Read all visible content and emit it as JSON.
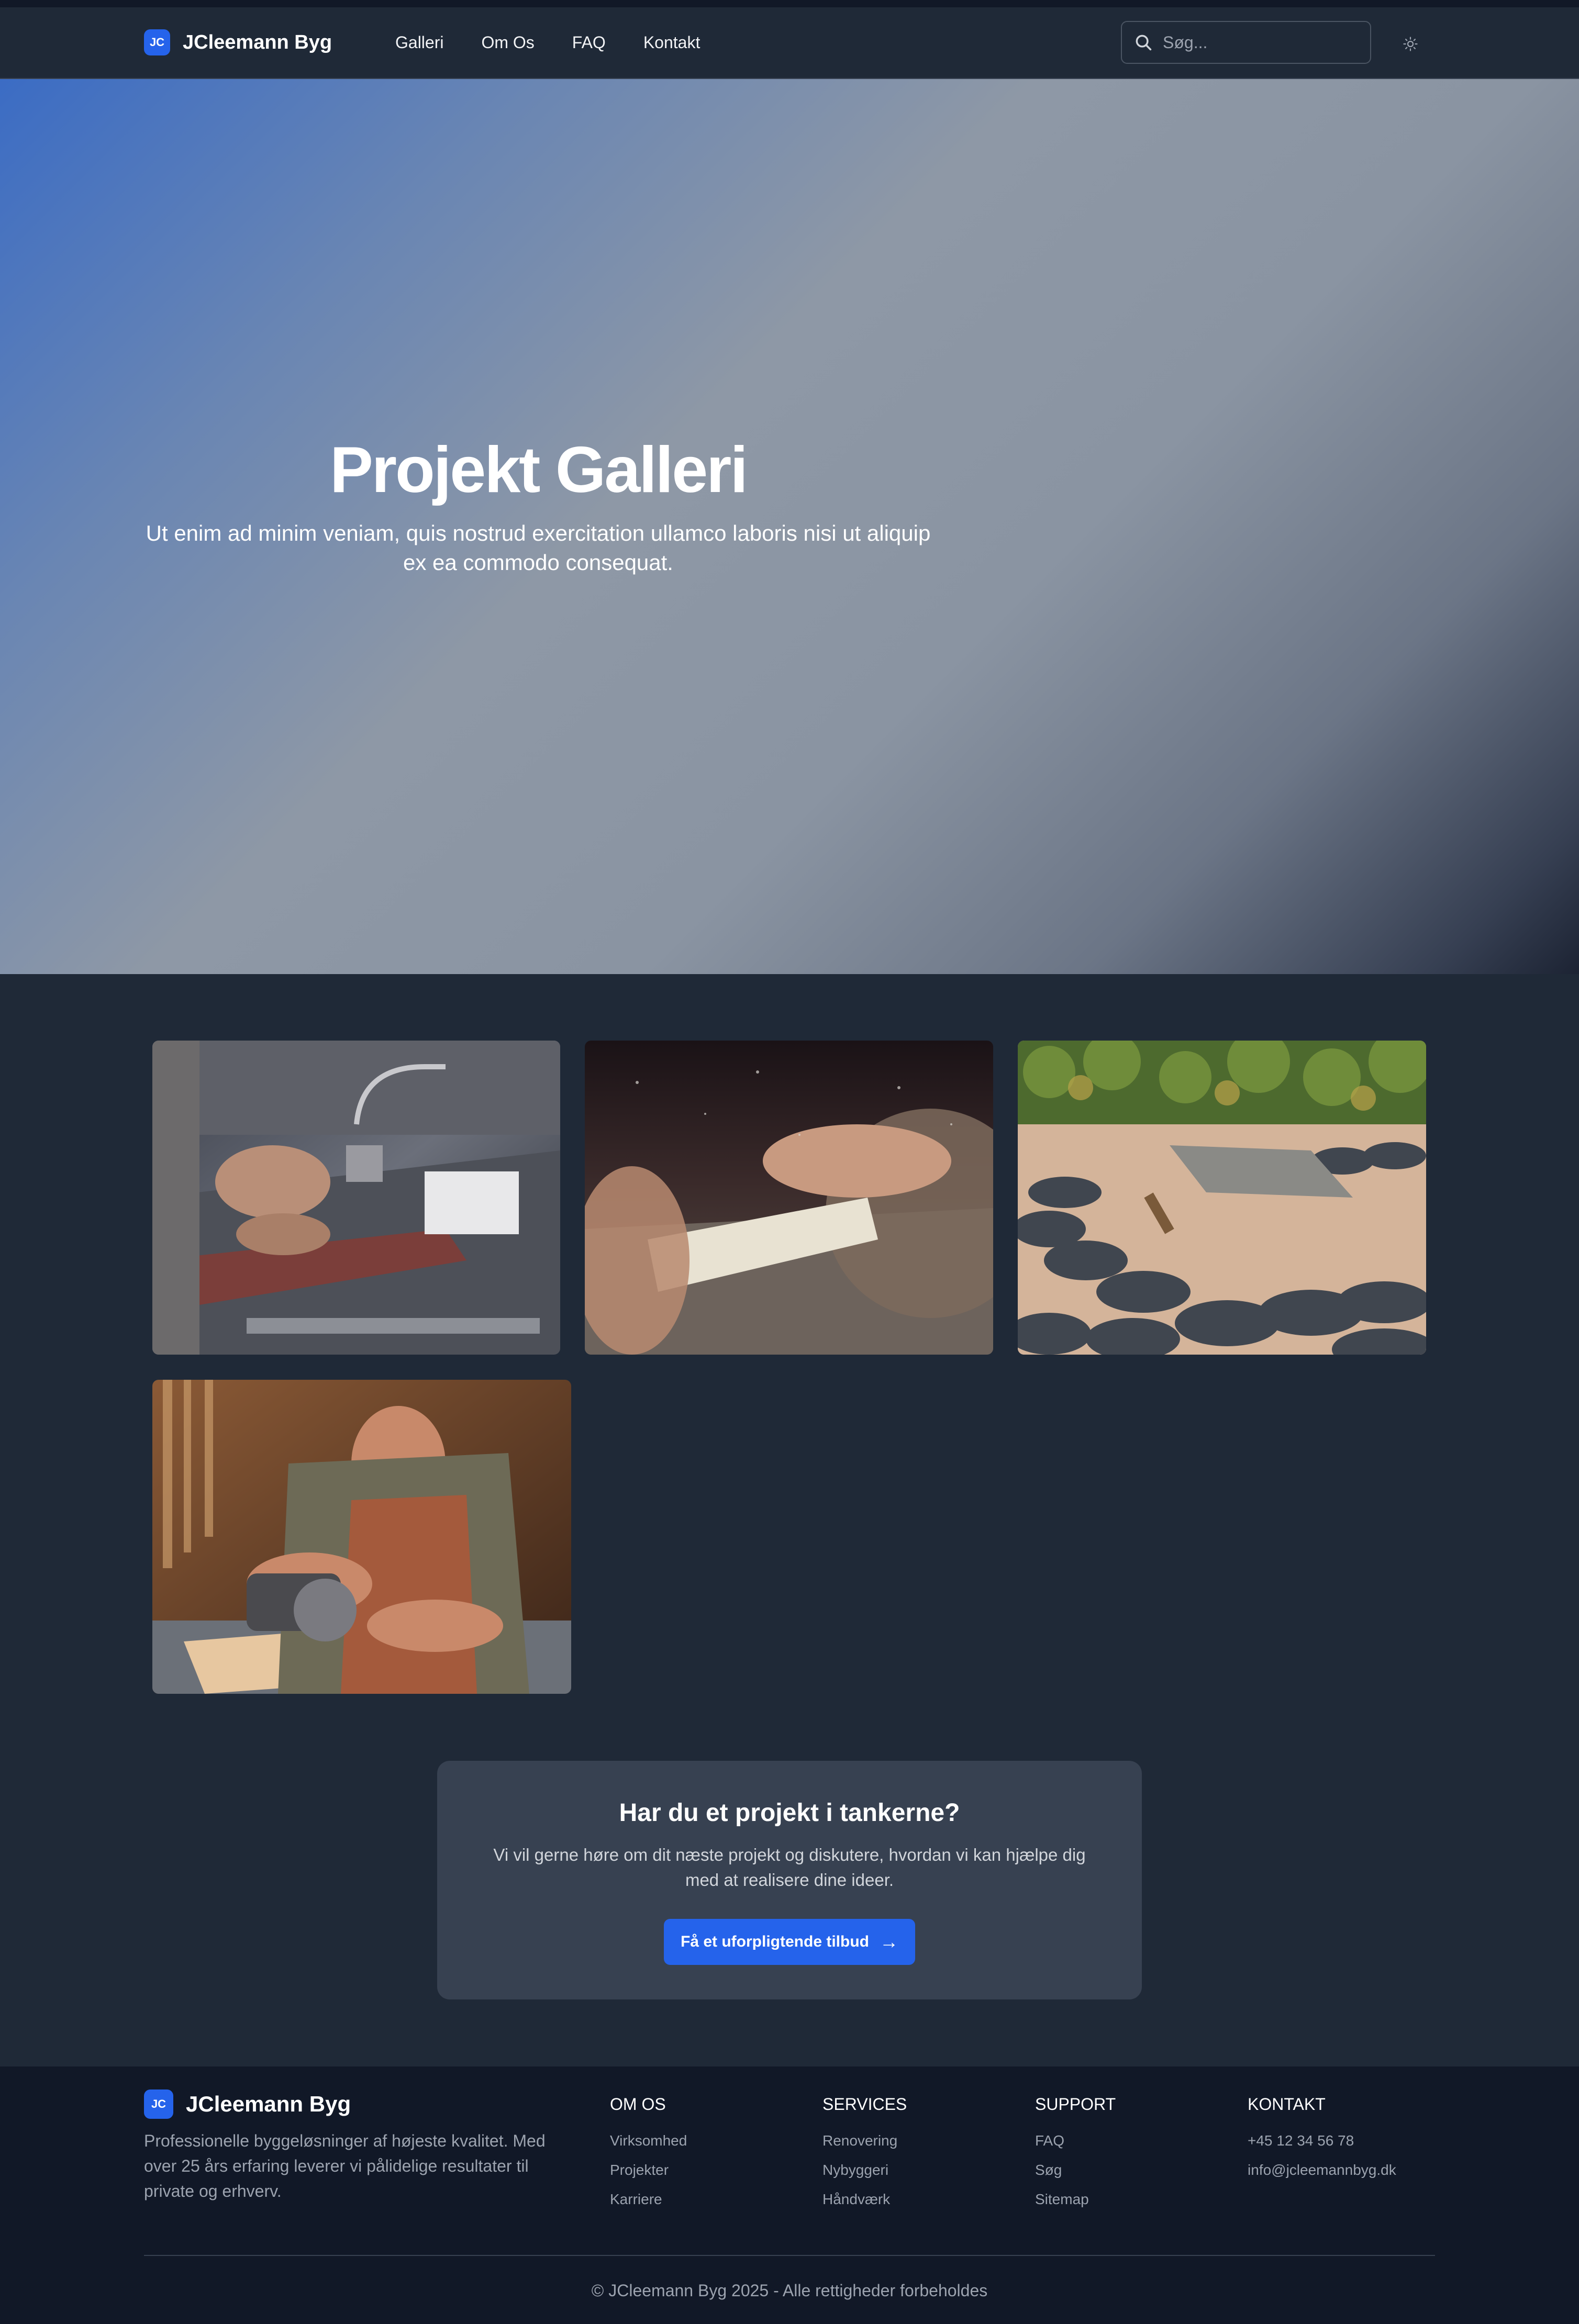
{
  "header": {
    "logo_initials": "JC",
    "brand_name": "JCleemann Byg",
    "nav": [
      "Galleri",
      "Om Os",
      "FAQ",
      "Kontakt"
    ],
    "search_placeholder": "Søg...",
    "search_icon": "search-icon",
    "theme_icon": "sun-icon"
  },
  "hero": {
    "title": "Projekt Galleri",
    "subtitle": "Ut enim ad minim veniam, quis nostrud exercitation ullamco laboris nisi ut aliquip ex ea commodo consequat."
  },
  "gallery": {
    "images": [
      "router-table-hands",
      "table-saw-wood-cut",
      "slate-roof-tools",
      "carpenter-planing-wood"
    ]
  },
  "cta": {
    "title": "Har du et projekt i tankerne?",
    "text": "Vi vil gerne høre om dit næste projekt og diskutere, hvordan vi kan hjælpe dig med at realisere dine ideer.",
    "button": "Få et uforpligtende tilbud",
    "button_icon": "arrow-right-icon"
  },
  "footer": {
    "logo_initials": "JC",
    "brand_name": "JCleemann Byg",
    "description": "Professionelle byggeløsninger af højeste kvalitet. Med over 25 års erfaring leverer vi pålidelige resultater til private og erhverv.",
    "columns": [
      {
        "title": "OM OS",
        "links": [
          "Virksomhed",
          "Projekter",
          "Karriere"
        ]
      },
      {
        "title": "SERVICES",
        "links": [
          "Renovering",
          "Nybyggeri",
          "Håndværk"
        ]
      },
      {
        "title": "SUPPORT",
        "links": [
          "FAQ",
          "Søg",
          "Sitemap"
        ]
      },
      {
        "title": "KONTAKT",
        "links": [
          "+45 12 34 56 78",
          "info@jcleemannbyg.dk"
        ]
      }
    ],
    "copyright": "© JCleemann Byg 2025 - Alle rettigheder forbeholdes"
  },
  "colors": {
    "accent": "#2563eb",
    "page_bg": "#1f2937",
    "footer_bg": "#111827",
    "card_bg": "#374151"
  }
}
